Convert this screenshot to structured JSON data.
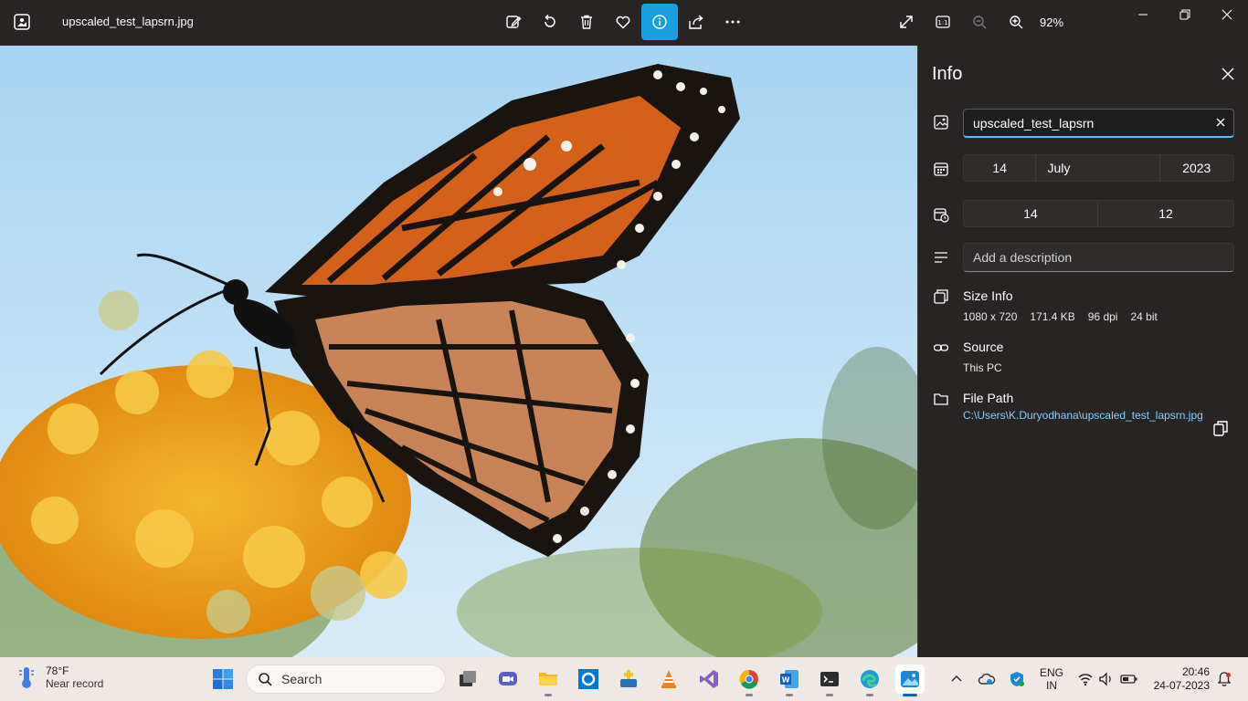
{
  "window": {
    "file_name": "upscaled_test_lapsrn.jpg",
    "zoom": "92%"
  },
  "info": {
    "title": "Info",
    "name_value": "upscaled_test_lapsrn",
    "date": {
      "day": "14",
      "month": "July",
      "year": "2023"
    },
    "time": {
      "hour": "14",
      "minute": "12"
    },
    "description_placeholder": "Add a description",
    "size_info": {
      "title": "Size Info",
      "dimensions": "1080 x 720",
      "file_size": "171.4 KB",
      "dpi": "96 dpi",
      "bit_depth": "24 bit"
    },
    "source": {
      "title": "Source",
      "value": "This PC"
    },
    "file_path": {
      "title": "File Path",
      "value": "C:\\Users\\K.Duryodhana\\upscaled_test_lapsrn.jpg"
    }
  },
  "taskbar": {
    "weather_temp": "78°F",
    "weather_condition": "Near record",
    "search_label": "Search",
    "lang_top": "ENG",
    "lang_bottom": "IN",
    "time": "20:46",
    "date": "24-07-2023"
  },
  "icons": [
    "photos-app-icon",
    "edit-icon",
    "rotate-icon",
    "delete-icon",
    "favorite-icon",
    "info-icon",
    "share-icon",
    "more-icon",
    "fullscreen-icon",
    "actual-size-icon",
    "zoom-out-icon",
    "zoom-in-icon",
    "minimize-icon",
    "maximize-icon",
    "close-icon"
  ]
}
